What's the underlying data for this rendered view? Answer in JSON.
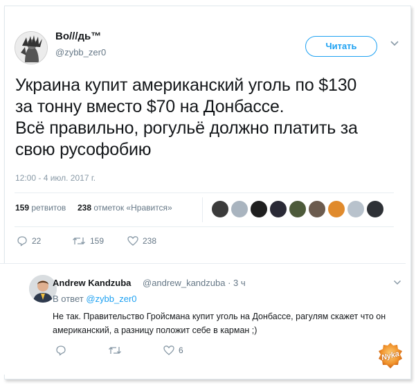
{
  "tweet": {
    "display_name": "Во///дь™",
    "handle": "@zybb_zer0",
    "follow_label": "Читать",
    "text": "Украина купит американский уголь по $130\nза тонну вместо $70 на Донбассе.\nВсё правильно, рогульё должно платить за\nсвою русофобию",
    "timestamp": "12:00 - 4 июл. 2017 г.",
    "retweets_count": "159",
    "retweets_label": "ретвитов",
    "likes_count": "238",
    "likes_label": "отметок «Нравится»",
    "actions": {
      "reply_count": "22",
      "retweet_count": "159",
      "like_count": "238"
    }
  },
  "reply": {
    "display_name": "Andrew Kandzuba",
    "handle": "@andrew_kandzuba",
    "time": "· 3 ч",
    "in_reply_prefix": "В ответ",
    "in_reply_handle": "@zybb_zer0",
    "text": "Не так. Правительство Гройсмана купит уголь на Донбассе, рагулям скажет что он американский, а разницу положит себе в карман ;)",
    "actions": {
      "like_count": "6"
    }
  },
  "watermark": {
    "text": "Nyka"
  },
  "colors": {
    "accent": "#1da1f2",
    "muted": "#657786",
    "text": "#14171a",
    "border": "#e1e8ed"
  },
  "icons": [
    "avatar-illustration",
    "chevron-down-icon",
    "reply-icon",
    "retweet-icon",
    "heart-icon"
  ]
}
